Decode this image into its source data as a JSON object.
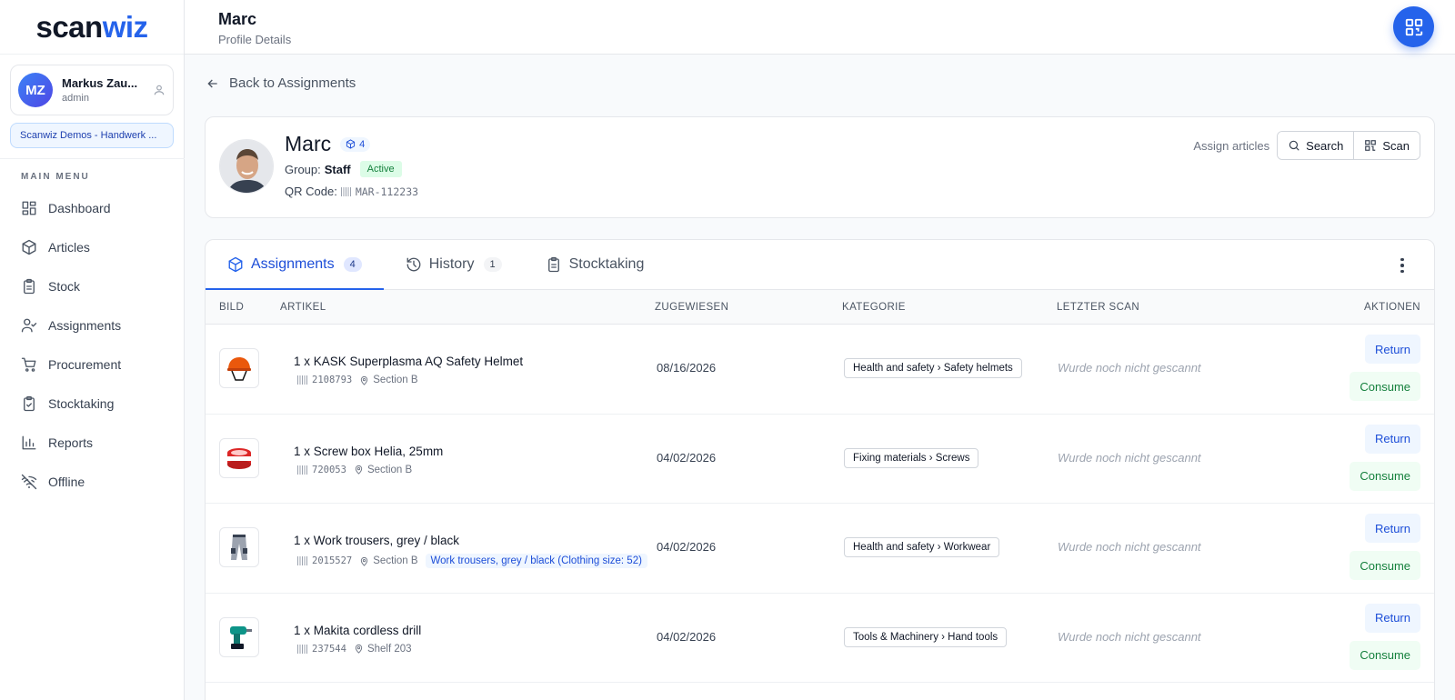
{
  "logo": {
    "part1": "scan",
    "part2": "wiz"
  },
  "user": {
    "initials": "MZ",
    "name": "Markus Zau...",
    "role": "admin",
    "org": "Scanwiz Demos - Handwerk ..."
  },
  "menu": {
    "title": "MAIN MENU",
    "items": [
      {
        "label": "Dashboard",
        "icon": "dashboard-icon"
      },
      {
        "label": "Articles",
        "icon": "box-icon"
      },
      {
        "label": "Stock",
        "icon": "clipboard-icon"
      },
      {
        "label": "Assignments",
        "icon": "user-check-icon"
      },
      {
        "label": "Procurement",
        "icon": "cart-icon"
      },
      {
        "label": "Stocktaking",
        "icon": "clipboard-check-icon"
      },
      {
        "label": "Reports",
        "icon": "bar-chart-icon"
      },
      {
        "label": "Offline",
        "icon": "wifi-off-icon"
      }
    ]
  },
  "header": {
    "title": "Marc",
    "subtitle": "Profile Details"
  },
  "back_label": "Back to Assignments",
  "profile": {
    "name": "Marc",
    "count": "4",
    "group_label": "Group:",
    "group": "Staff",
    "status": "Active",
    "qr_label": "QR Code:",
    "qr_code": "MAR-112233",
    "assign_label": "Assign articles",
    "search_label": "Search",
    "scan_label": "Scan"
  },
  "tabs": [
    {
      "label": "Assignments",
      "count": "4",
      "icon": "box-icon"
    },
    {
      "label": "History",
      "count": "1",
      "icon": "history-icon"
    },
    {
      "label": "Stocktaking",
      "icon": "clipboard-icon"
    }
  ],
  "columns": {
    "image": "BILD",
    "article": "ARTIKEL",
    "assigned": "ZUGEWIESEN",
    "category": "KATEGORIE",
    "last_scan": "LETZTER SCAN",
    "actions": "AKTIONEN"
  },
  "rows": [
    {
      "title": "1 x KASK Superplasma AQ Safety Helmet",
      "code": "2108793",
      "location": "Section B",
      "variant": "",
      "date": "08/16/2026",
      "category": "Health and safety › Safety helmets",
      "last_scan": "Wurde noch nicht gescannt",
      "return": "Return",
      "consume": "Consume",
      "image": "helmet"
    },
    {
      "title": "1 x Screw box Helia, 25mm",
      "code": "720053",
      "location": "Section B",
      "variant": "",
      "date": "04/02/2026",
      "category": "Fixing materials › Screws",
      "last_scan": "Wurde noch nicht gescannt",
      "return": "Return",
      "consume": "Consume",
      "image": "screw-box"
    },
    {
      "title": "1 x Work trousers, grey / black",
      "code": "2015527",
      "location": "Section B",
      "variant": "Work trousers, grey / black (Clothing size: 52)",
      "date": "04/02/2026",
      "category": "Health and safety › Workwear",
      "last_scan": "Wurde noch nicht gescannt",
      "return": "Return",
      "consume": "Consume",
      "image": "trousers"
    },
    {
      "title": "1 x Makita cordless drill",
      "code": "237544",
      "location": "Shelf 203",
      "variant": "",
      "date": "04/02/2026",
      "category": "Tools & Machinery › Hand tools",
      "last_scan": "Wurde noch nicht gescannt",
      "return": "Return",
      "consume": "Consume",
      "image": "drill"
    }
  ]
}
